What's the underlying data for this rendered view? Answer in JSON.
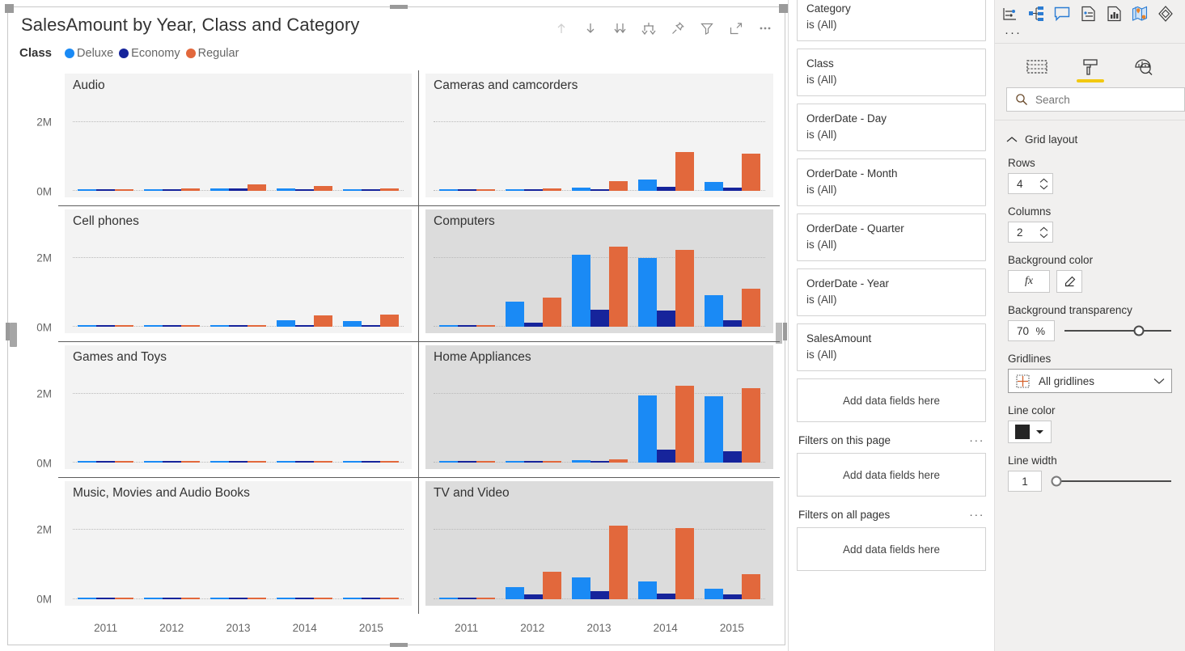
{
  "visual": {
    "title": "SalesAmount by Year, Class and Category",
    "legend_title": "Class",
    "toolbar": [
      {
        "name": "drill-up-icon",
        "title": "Drill up"
      },
      {
        "name": "drill-down-icon",
        "title": "Drill down"
      },
      {
        "name": "expand-all-icon",
        "title": "Go to the next level in the hierarchy"
      },
      {
        "name": "expand-hierarchy-icon",
        "title": "Expand all down one level in the hierarchy"
      },
      {
        "name": "pin-icon",
        "title": "Pin visual"
      },
      {
        "name": "filter-icon",
        "title": "Filters"
      },
      {
        "name": "focus-mode-icon",
        "title": "Focus mode"
      },
      {
        "name": "more-options-icon",
        "title": "More options"
      }
    ]
  },
  "chart_data": {
    "type": "bar",
    "title": "SalesAmount by Year, Class and Category",
    "xlabel": "",
    "ylabel": "",
    "ylim": [
      0,
      2800000
    ],
    "ytick_labels": [
      "0M",
      "2M"
    ],
    "ytick_values": [
      0,
      2000000
    ],
    "grid": true,
    "legend_position": "top-left",
    "legend": [
      "Deluxe",
      "Economy",
      "Regular"
    ],
    "colors": {
      "Deluxe": "#1A8AF5",
      "Economy": "#16249B",
      "Regular": "#E2683C"
    },
    "categories": [
      "2011",
      "2012",
      "2013",
      "2014",
      "2015"
    ],
    "small_multiples_rows": 4,
    "small_multiples_columns": 2,
    "panels": [
      {
        "category": "Audio",
        "highlighted": false,
        "series": [
          {
            "name": "Deluxe",
            "values": [
              30000,
              45000,
              70000,
              75000,
              45000
            ]
          },
          {
            "name": "Economy",
            "values": [
              25000,
              30000,
              60000,
              40000,
              30000
            ]
          },
          {
            "name": "Regular",
            "values": [
              35000,
              75000,
              185000,
              145000,
              75000
            ]
          }
        ]
      },
      {
        "category": "Cameras and camcorders",
        "highlighted": false,
        "series": [
          {
            "name": "Deluxe",
            "values": [
              30000,
              45000,
              90000,
              330000,
              250000
            ]
          },
          {
            "name": "Economy",
            "values": [
              25000,
              30000,
              45000,
              110000,
              100000
            ]
          },
          {
            "name": "Regular",
            "values": [
              35000,
              75000,
              290000,
              1130000,
              1085000
            ]
          }
        ]
      },
      {
        "category": "Cell phones",
        "highlighted": false,
        "series": [
          {
            "name": "Deluxe",
            "values": [
              0,
              0,
              50000,
              180000,
              175000
            ]
          },
          {
            "name": "Economy",
            "values": [
              0,
              0,
              25000,
              30000,
              30000
            ]
          },
          {
            "name": "Regular",
            "values": [
              0,
              0,
              35000,
              330000,
              345000
            ]
          }
        ]
      },
      {
        "category": "Computers",
        "highlighted": true,
        "series": [
          {
            "name": "Deluxe",
            "values": [
              40000,
              730000,
              2090000,
              2010000,
              920000
            ]
          },
          {
            "name": "Economy",
            "values": [
              30000,
              115000,
              500000,
              470000,
              200000
            ]
          },
          {
            "name": "Regular",
            "values": [
              25000,
              840000,
              2320000,
              2240000,
              1110000
            ]
          }
        ]
      },
      {
        "category": "Games and Toys",
        "highlighted": false,
        "series": [
          {
            "name": "Deluxe",
            "values": [
              0,
              0,
              30000,
              35000,
              45000
            ]
          },
          {
            "name": "Economy",
            "values": [
              0,
              0,
              40000,
              35000,
              45000
            ]
          },
          {
            "name": "Regular",
            "values": [
              0,
              0,
              30000,
              30000,
              30000
            ]
          }
        ]
      },
      {
        "category": "Home Appliances",
        "highlighted": true,
        "series": [
          {
            "name": "Deluxe",
            "values": [
              0,
              0,
              75000,
              1950000,
              1930000
            ]
          },
          {
            "name": "Economy",
            "values": [
              0,
              0,
              25000,
              370000,
              340000
            ]
          },
          {
            "name": "Regular",
            "values": [
              0,
              0,
              85000,
              2230000,
              2160000
            ]
          }
        ]
      },
      {
        "category": "Music, Movies and Audio Books",
        "highlighted": false,
        "series": [
          {
            "name": "Deluxe",
            "values": [
              0,
              0,
              30000,
              35000,
              45000
            ]
          },
          {
            "name": "Economy",
            "values": [
              0,
              0,
              40000,
              35000,
              40000
            ]
          },
          {
            "name": "Regular",
            "values": [
              0,
              0,
              30000,
              30000,
              30000
            ]
          }
        ]
      },
      {
        "category": "TV and Video",
        "highlighted": true,
        "series": [
          {
            "name": "Deluxe",
            "values": [
              30000,
              350000,
              620000,
              520000,
              310000
            ]
          },
          {
            "name": "Economy",
            "values": [
              25000,
              130000,
              245000,
              175000,
              130000
            ]
          },
          {
            "name": "Regular",
            "values": [
              30000,
              800000,
              2120000,
              2060000,
              730000
            ]
          }
        ]
      }
    ]
  },
  "filter_pane": {
    "cards": [
      {
        "name": "Category",
        "value": "is (All)"
      },
      {
        "name": "Class",
        "value": "is (All)"
      },
      {
        "name": "OrderDate - Day",
        "value": "is (All)"
      },
      {
        "name": "OrderDate - Month",
        "value": "is (All)"
      },
      {
        "name": "OrderDate - Quarter",
        "value": "is (All)"
      },
      {
        "name": "OrderDate - Year",
        "value": "is (All)"
      },
      {
        "name": "SalesAmount",
        "value": "is (All)"
      }
    ],
    "visual_dropzone": "Add data fields here",
    "sections": [
      {
        "title": "Filters on this page",
        "dropzone": "Add data fields here",
        "menu": "···"
      },
      {
        "title": "Filters on all pages",
        "dropzone": "Add data fields here",
        "menu": "···"
      }
    ]
  },
  "format_pane": {
    "gallery_icons": [
      "key-influencers-icon",
      "decomposition-tree-icon",
      "qna-icon",
      "smart-narrative-icon",
      "paginated-report-icon",
      "azure-map-icon",
      "power-apps-icon"
    ],
    "gallery_more": "···",
    "tabs": [
      {
        "name": "fields-tab",
        "icon": "fields-table-icon",
        "active": false
      },
      {
        "name": "format-tab",
        "icon": "paint-roller-icon",
        "active": true
      },
      {
        "name": "analytics-tab",
        "icon": "magnifier-chart-icon",
        "active": false
      }
    ],
    "search": {
      "placeholder": "Search",
      "value": ""
    },
    "section": {
      "title": "Grid layout",
      "expanded": true
    },
    "controls": {
      "rows_label": "Rows",
      "rows_value": "4",
      "columns_label": "Columns",
      "columns_value": "2",
      "background_color_label": "Background color",
      "fx_label": "fx",
      "reset_label": "revert-icon",
      "background_transparency_label": "Background transparency",
      "background_transparency_value": "70",
      "background_transparency_unit": "%",
      "gridlines_label": "Gridlines",
      "gridlines_value": "All gridlines",
      "line_color_label": "Line color",
      "line_color_value": "#252525",
      "line_width_label": "Line width",
      "line_width_value": "1"
    }
  }
}
